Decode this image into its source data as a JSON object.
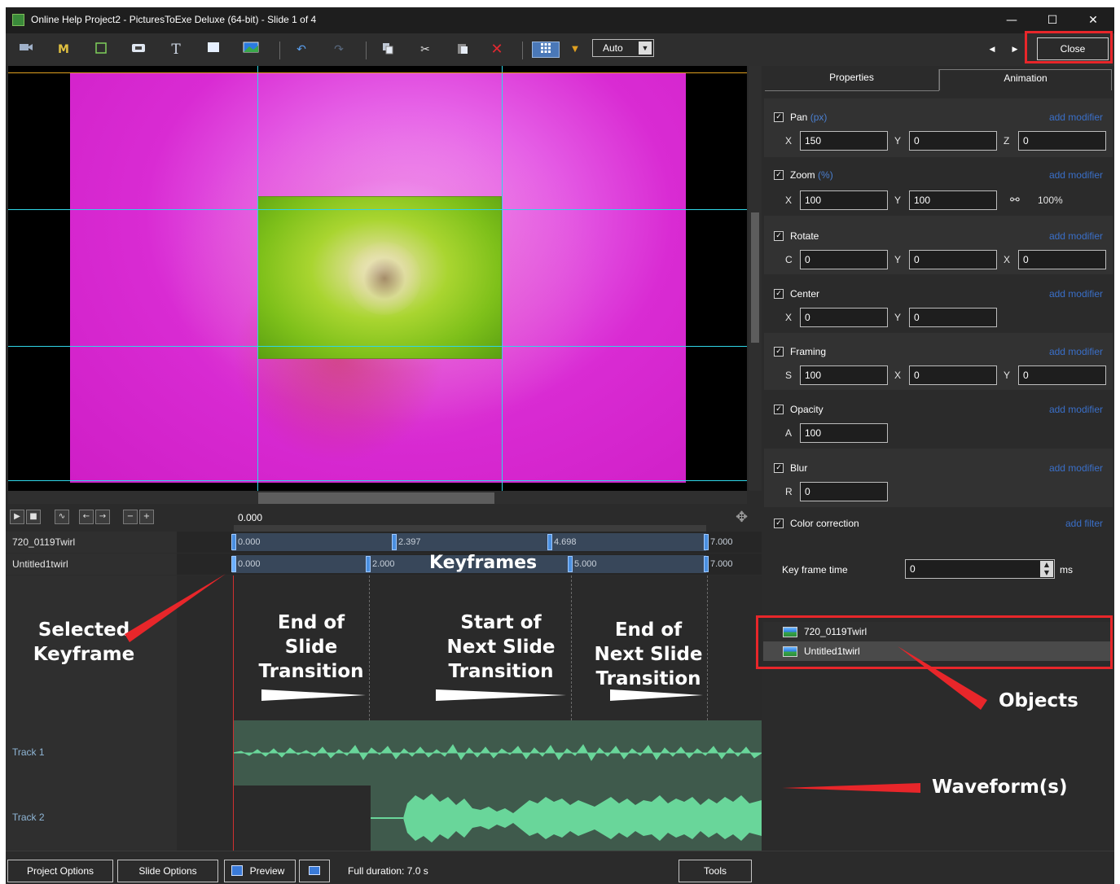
{
  "window": {
    "title": "Online Help Project2 - PicturesToExe Deluxe (64-bit) - Slide 1 of 4",
    "controls": {
      "minimize": "—",
      "maximize": "☐",
      "close": "✕"
    }
  },
  "toolbar": {
    "zoom_select": "Auto",
    "close_label": "Close",
    "icons": [
      "camera-icon",
      "mask-icon",
      "frame-icon",
      "button-icon",
      "text-icon",
      "rectangle-icon",
      "image-icon",
      "undo-icon",
      "redo-icon",
      "copy-icon",
      "cut-icon",
      "paste-icon",
      "delete-icon",
      "grid-icon",
      "dropdown-arrow-icon",
      "prev-icon",
      "next-icon"
    ],
    "text_glyph": "T",
    "mask_glyph": "M"
  },
  "timeline": {
    "current_time": "0.000",
    "objects": [
      {
        "name": "720_0119Twirl",
        "keyframes": [
          "0.000",
          "2.397",
          "4.698",
          "7.000"
        ]
      },
      {
        "name": "Untitled1twirl",
        "keyframes": [
          "0.000",
          "2.000",
          "5.000",
          "7.000"
        ]
      }
    ],
    "tracks": [
      {
        "name": "Track 1"
      },
      {
        "name": "Track 2"
      }
    ]
  },
  "annotations": {
    "keyframes": "Keyframes",
    "selected_keyframe": [
      "Selected",
      "Keyframe"
    ],
    "end_of_slide_transition": [
      "End of",
      "Slide",
      "Transition"
    ],
    "start_of_next_slide_transition": [
      "Start of",
      "Next Slide",
      "Transition"
    ],
    "end_of_next_slide_transition": [
      "End of",
      "Next Slide",
      "Transition"
    ],
    "objects": "Objects",
    "waveforms": "Waveform(s)",
    "highlight_color": "#e8262a"
  },
  "panel": {
    "tabs": [
      "Properties",
      "Animation"
    ],
    "active_tab": "Animation",
    "add_modifier": "add modifier",
    "add_filter": "add filter",
    "groups": {
      "pan": {
        "label": "Pan",
        "unit": "(px)",
        "x": "150",
        "y": "0",
        "z": "0"
      },
      "zoom": {
        "label": "Zoom",
        "unit": "(%)",
        "x": "100",
        "y": "100",
        "link_value": "100%"
      },
      "rotate": {
        "label": "Rotate",
        "c": "0",
        "y": "0",
        "x": "0"
      },
      "center": {
        "label": "Center",
        "x": "0",
        "y": "0"
      },
      "framing": {
        "label": "Framing",
        "s": "100",
        "x": "0",
        "y": "0"
      },
      "opacity": {
        "label": "Opacity",
        "a": "100"
      },
      "blur": {
        "label": "Blur",
        "r": "0"
      },
      "color_correction": {
        "label": "Color correction"
      }
    },
    "keyframe_time": {
      "label": "Key frame time",
      "value": "0",
      "unit": "ms"
    },
    "object_list": [
      "720_0119Twirl",
      "Untitled1twirl"
    ]
  },
  "statusbar": {
    "project_options": "Project Options",
    "slide_options": "Slide Options",
    "preview": "Preview",
    "full_duration": "Full duration: 7.0 s",
    "tools": "Tools"
  }
}
